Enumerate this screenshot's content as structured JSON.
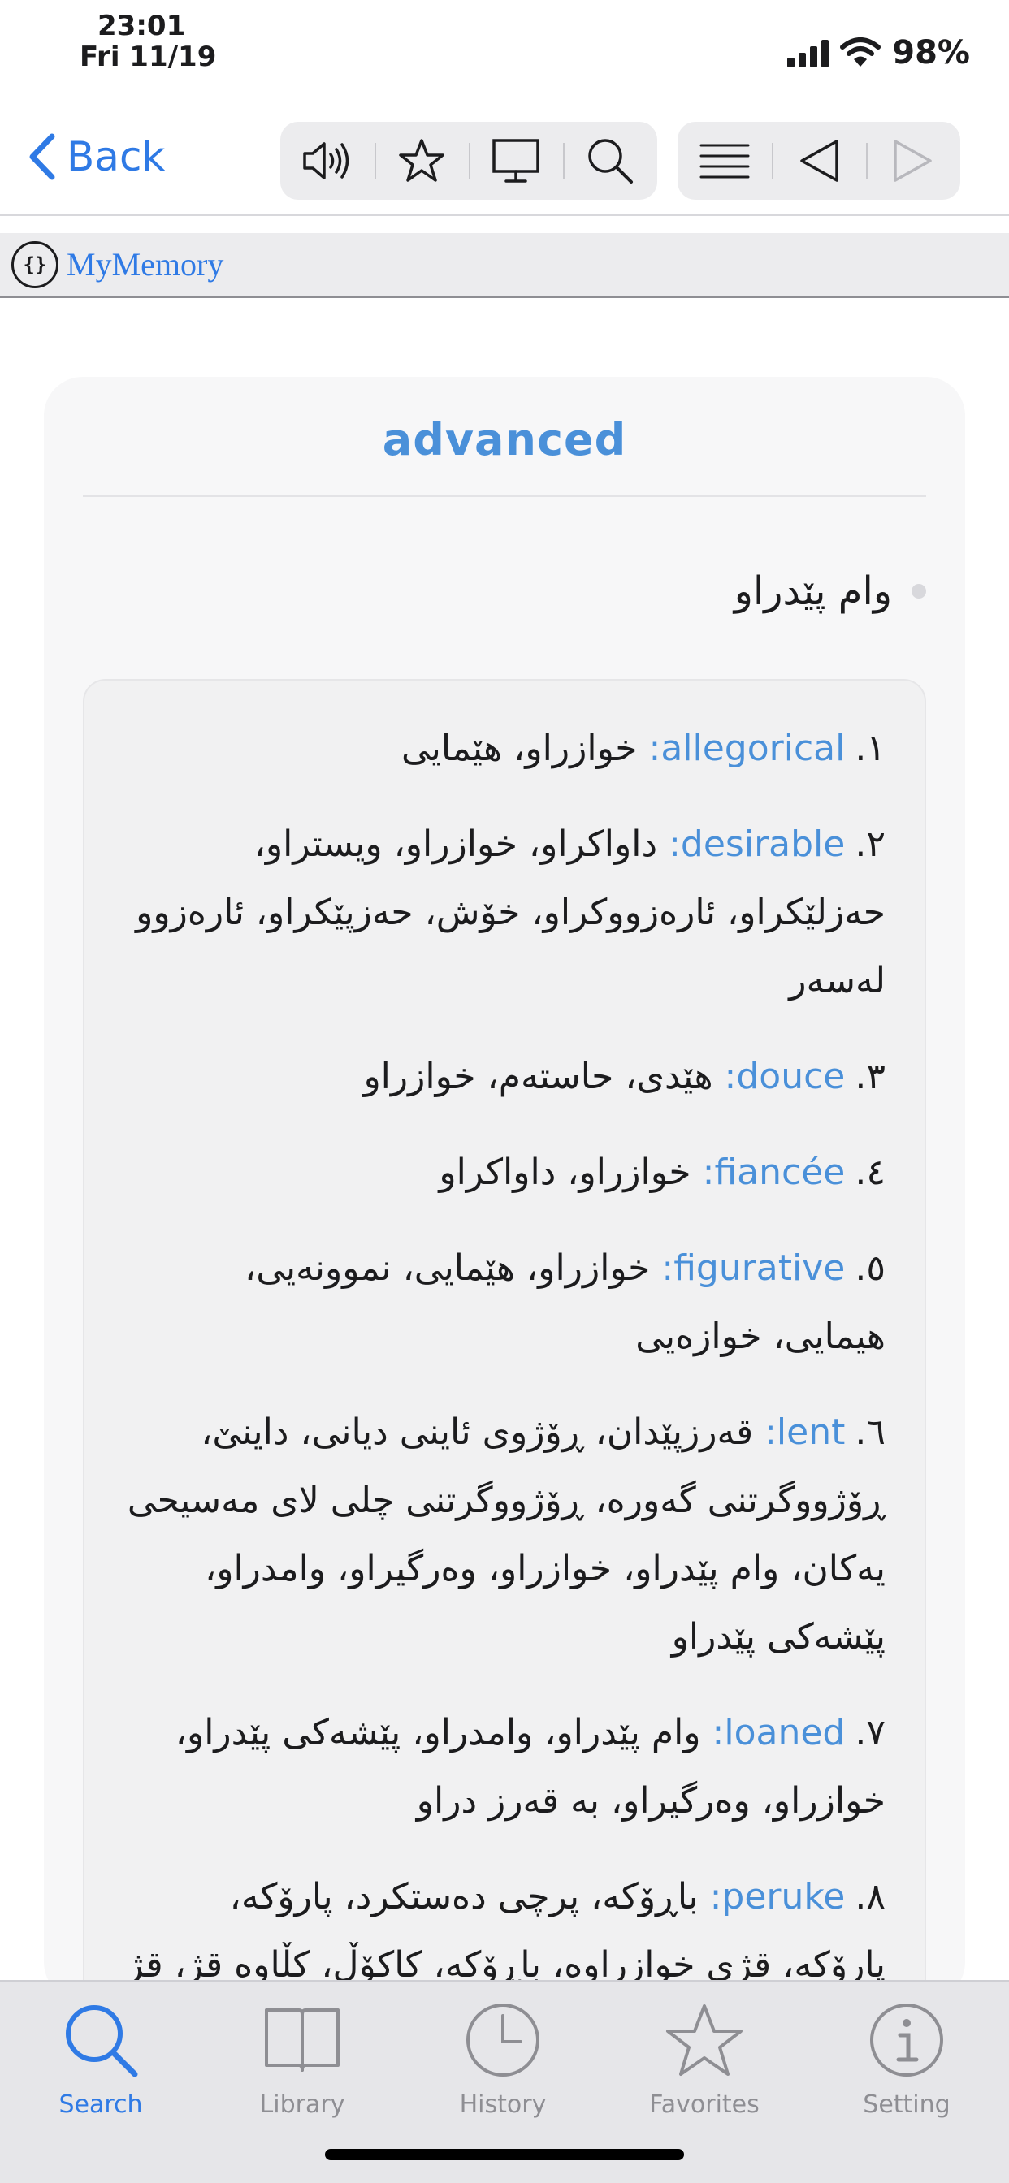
{
  "status": {
    "time": "23:01",
    "date": "Fri 11/19",
    "battery": "98%",
    "icons": [
      "signal-icon",
      "wifi-icon"
    ]
  },
  "nav": {
    "back_label": "Back",
    "tools": [
      "speaker-icon",
      "star-icon",
      "monitor-icon",
      "search-icon",
      "list-icon",
      "prev-triangle-icon",
      "next-triangle-icon"
    ]
  },
  "source": {
    "logo": "{}",
    "title": "MyMemory"
  },
  "card": {
    "title": "advanced",
    "headword": "وام پێدراو",
    "definitions": [
      {
        "num": "١.",
        "word": "allegorical:",
        "text": " خوازراو، هێمایی"
      },
      {
        "num": "٢.",
        "word": "desirable:",
        "text": " داواکراو، خوازراو، ویستراو، حەزلێکراو، ئارەزووکراو، خۆش، حەزپێکراو، ئارەزوو لەسەر"
      },
      {
        "num": "٣.",
        "word": "douce:",
        "text": " هێدی، حاستەم، خوازراو"
      },
      {
        "num": "٤.",
        "word": "fiancée:",
        "text": " خوازراو، داواکراو"
      },
      {
        "num": "٥.",
        "word": "figurative:",
        "text": " خوازراو، هێمایی، نموونەیی، هیمایی، خوازەیی"
      },
      {
        "num": "٦.",
        "word": "lent:",
        "text": " قەرزپێدان، ڕۆژوی ئاینی دیانی، داینێ، ڕۆژووگرتنی گەورە، ڕۆژووگرتنی چلی لای مەسیحی یەکان، وام پێدراو، خوازراو، وەرگیراو، وامدراو، پێشەکی پێدراو"
      },
      {
        "num": "٧.",
        "word": "loaned:",
        "text": " وام پێدراو، وامدراو، پێشەکی پێدراو، خوازراو، وەرگیراو، بە قەرز دراو"
      },
      {
        "num": "٨.",
        "word": "peruke:",
        "text": " باڕۆکە، پرچی دەستکرد، پارۆکە، پارۆکە، قژی خوازراوە، باڕۆکە، کاکۆڵ، کڵاوە قژ، قژ"
      }
    ]
  },
  "tabs": [
    {
      "label": "Search",
      "icon": "search-icon",
      "active": true
    },
    {
      "label": "Library",
      "icon": "book-icon",
      "active": false
    },
    {
      "label": "History",
      "icon": "clock-icon",
      "active": false
    },
    {
      "label": "Favorites",
      "icon": "star-icon",
      "active": false
    },
    {
      "label": "Setting",
      "icon": "info-icon",
      "active": false
    }
  ],
  "colors": {
    "accent": "#2f7ae5",
    "title_blue": "#4a90d9",
    "inactive": "#8e8e93"
  }
}
